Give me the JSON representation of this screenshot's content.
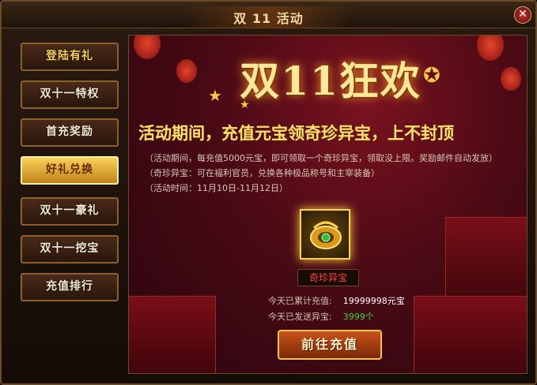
{
  "window": {
    "title": "双 11 活动",
    "close_glyph": "✕"
  },
  "sidebar": {
    "items": [
      {
        "label": "登陆有礼"
      },
      {
        "label": "双十一特权"
      },
      {
        "label": "首充奖励"
      },
      {
        "label": "好礼兑换"
      },
      {
        "label": "双十一豪礼"
      },
      {
        "label": "双十一挖宝"
      },
      {
        "label": "充值排行"
      }
    ],
    "active_index": 3
  },
  "main": {
    "banner_text": "双11狂欢",
    "headline": "活动期间，充值元宝领奇珍异宝，上不封顶",
    "info_lines": [
      "（活动期间，每充值5000元宝，即可领取一个奇珍异宝，领取没上限。奖励邮件自动发放）",
      "（奇珍异宝：可在福利官员，兑换各种极品称号和主宰装备）",
      "（活动时间：11月10日-11月12日）"
    ],
    "reward": {
      "icon": "jade-pendant-icon",
      "label": "奇珍异宝"
    },
    "stats": [
      {
        "label": "今天已累计充值:",
        "value": "19999998元宝",
        "color": "#ffffff"
      },
      {
        "label": "今天已发送异宝:",
        "value": "3999个",
        "color": "#3fd83f"
      }
    ],
    "recharge_label": "前往充值"
  },
  "colors": {
    "accent": "#f5d060",
    "reward_red": "#ff4a3a",
    "count_green": "#3fd83f"
  }
}
